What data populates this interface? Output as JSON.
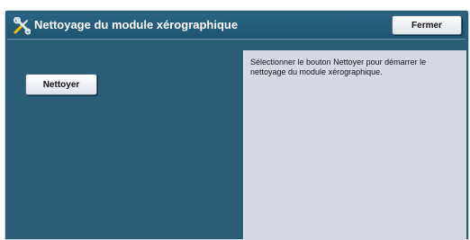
{
  "header": {
    "icon": "tools-icon",
    "title": "Nettoyage du module xérographique",
    "close_label": "Fermer"
  },
  "actions": {
    "clean_label": "Nettoyer"
  },
  "info": {
    "text": "Sélectionner le bouton Nettoyer pour démarrer le nettoyage du module xérographique."
  },
  "colors": {
    "panel_background": "#2a5e76",
    "info_background": "#d6d8e6",
    "header_text": "#ffffff"
  }
}
